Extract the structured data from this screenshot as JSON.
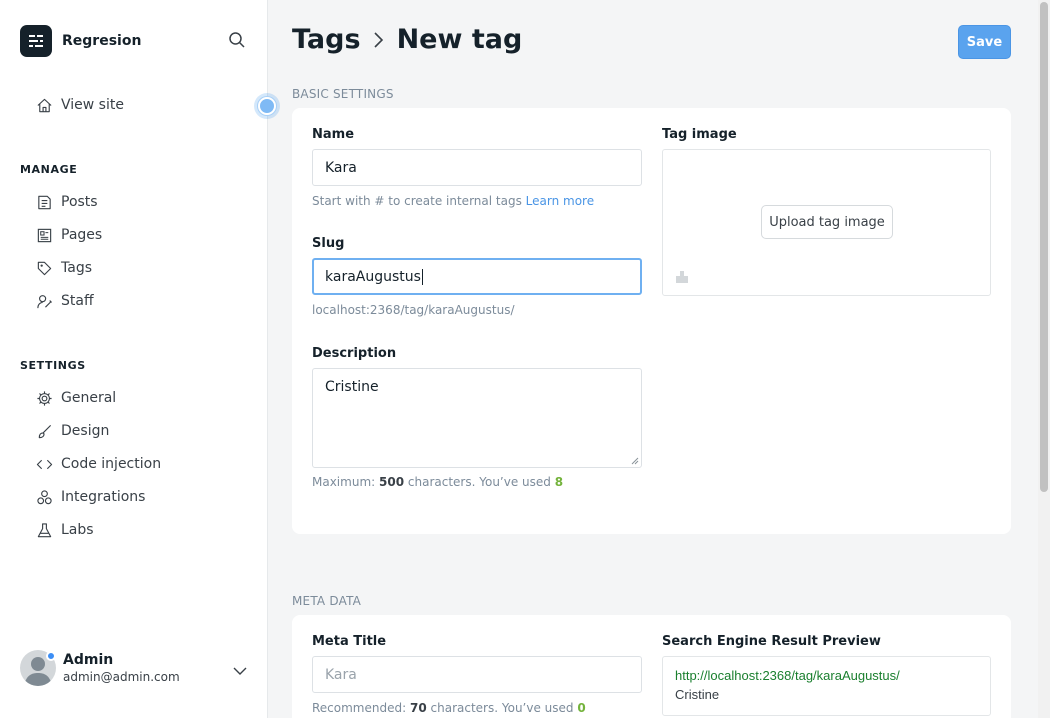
{
  "sidebar": {
    "brand": "Regresion",
    "view_site": "View site",
    "manage_label": "MANAGE",
    "manage_items": [
      "Posts",
      "Pages",
      "Tags",
      "Staff"
    ],
    "settings_label": "SETTINGS",
    "settings_items": [
      "General",
      "Design",
      "Code injection",
      "Integrations",
      "Labs"
    ],
    "user": {
      "name": "Admin",
      "email": "admin@admin.com"
    }
  },
  "header": {
    "crumb_parent": "Tags",
    "crumb_current": "New tag",
    "save_label": "Save"
  },
  "basic": {
    "title": "BASIC SETTINGS",
    "name_label": "Name",
    "name_value": "Kara",
    "name_hint": "Start with # to create internal tags",
    "learn_more": "Learn more",
    "slug_label": "Slug",
    "slug_value": "karaAugustus",
    "slug_url": "localhost:2368/tag/karaAugustus/",
    "desc_label": "Description",
    "desc_value": "Cristine",
    "desc_hint_prefix": "Maximum:",
    "desc_max": "500",
    "desc_hint_mid": "characters. You’ve used",
    "desc_used": "8",
    "image_label": "Tag image",
    "upload_label": "Upload tag image"
  },
  "meta": {
    "title": "META DATA",
    "meta_title_label": "Meta Title",
    "meta_title_placeholder": "Kara",
    "meta_hint_prefix": "Recommended:",
    "meta_recommended": "70",
    "meta_hint_mid": "characters. You’ve used",
    "meta_used": "0",
    "serp_label": "Search Engine Result Preview",
    "serp_url": "http://localhost:2368/tag/karaAugustus/",
    "serp_desc": "Cristine"
  },
  "colors": {
    "accent": "#5aa3ee",
    "link": "#4a95e5",
    "used_count": "#74b33c",
    "serp_url": "#1a7f2e"
  }
}
